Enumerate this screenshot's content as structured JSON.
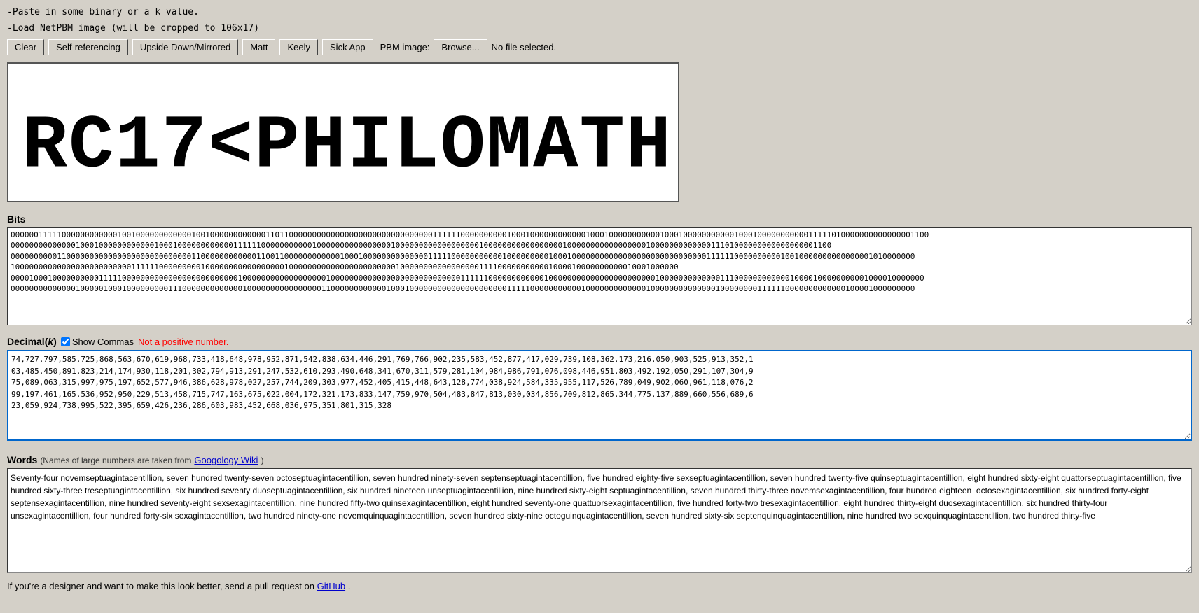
{
  "instructions": {
    "line1": "-Paste in some binary or a k value.",
    "line2": "-Load NetPBM image (will be cropped to 106x17)"
  },
  "toolbar": {
    "clear_label": "Clear",
    "self_ref_label": "Self-referencing",
    "upside_down_label": "Upside Down/Mirrored",
    "matt_label": "Matt",
    "keely_label": "Keely",
    "sick_app_label": "Sick App",
    "pbm_label": "PBM image:",
    "browse_label": "Browse...",
    "no_file_label": "No file selected."
  },
  "sections": {
    "bits_label": "Bits",
    "bits_value": "000000111110000000000001001000000000000100100000000000011011000000000000000000000000000000011111100000000001000100000000000010001000000000001000100000000000100010000000000011111010000000000000001100\n000000000000001000100000000000010001000000000000111111000000000001000000000000000010000000000000000001000000000000000001000000000000000001000000000000011101000000000000000001100\n000000000011000000000000000000000000000110000000000001100110000000000001000100000000000000111110000000000010000000001000100000000000000000000000000000111111000000000010010000000000000001010000000\n100000000000000000000000001111110000000001000000000000000001000000000000000000000001000000000000000001111000000000001000010000000000010001000000\n00001000100000000001111100000000000000000000000001000000000000000000100000000000000000000000000001111110000000000001000000000000000000000001000000000000011100000000000010000100000000001000010000000\n000000000000001000001000100000000011100000000000001000000000000000011000000000000100010000000000000000000001111100000000000100000000000001000000000000001000000001111110000000000000100001000000000",
    "decimal_label": "Decimal",
    "decimal_k": "k",
    "show_commas_label": "Show Commas",
    "not_positive_label": "Not a positive number.",
    "decimal_value": "74,727,797,585,725,868,563,670,619,968,733,418,648,978,952,871,542,838,634,446,291,769,766,902,235,583,452,877,417,029,739,108,362,173,216,050,903,525,913,352,1\n03,485,450,891,823,214,174,930,118,201,302,794,913,291,247,532,610,293,490,648,341,670,311,579,281,104,984,986,791,076,098,446,951,803,492,192,050,291,107,304,9\n75,089,063,315,997,975,197,652,577,946,386,628,978,027,257,744,209,303,977,452,405,415,448,643,128,774,038,924,584,335,955,117,526,789,049,902,060,961,118,076,2\n99,197,461,165,536,952,950,229,513,458,715,747,163,675,022,004,172,321,173,833,147,759,970,504,483,847,813,030,034,856,709,812,865,344,775,137,889,660,556,689,6\n23,059,924,738,995,522,395,659,426,236,286,603,983,452,668,036,975,351,801,315,328",
    "words_label": "Words",
    "words_subtitle": "(Names of large numbers are taken from",
    "googology_text": "Googology Wiki",
    "words_subtitle2": ")",
    "words_value": "Seventy-four novemseptuagintacentillion, seven hundred twenty-seven octoseptuagintacentillion, seven hundred ninety-seven septenseptuagintacentillion, five hundred eighty-five sexseptuagintacentillion, seven hundred twenty-five quinseptuagintacentillion, eight hundred sixty-eight quattorseptuagintacentillion, five hundred sixty-three treseptuagintacentillion, six hundred seventy duoseptuagintacentillion, six hundred nineteen unseptuagintacentillion, nine hundred sixty-eight septuagintacentillion, seven hundred thirty-three novemsexagintacentillion, four hundred eighteen  octosexagintacentillion, six hundred forty-eight septensexagintacentillion, nine hundred seventy-eight sexsexagintacentillion, nine hundred fifty-two quinsexagintacentillion, eight hundred seventy-one quattuorsexagintacentillion, five hundred forty-two tresexagintacentillion, eight hundred thirty-eight duosexagintacentillion, six hundred thirty-four unsexagintacentillion, four hundred forty-six sexagintacentillion, two hundred ninety-one novemquinquagintacentillion, seven hundred sixty-nine octoguinquagintacentillion, seven hundred sixty-six septenquinquagintacentillion, nine hundred two sexquinquagintacentillion, two hundred thirty-five",
    "footer_text": "If you're a designer and want to make this look better, send a pull request on",
    "github_text": "GitHub",
    "footer_end": "."
  }
}
